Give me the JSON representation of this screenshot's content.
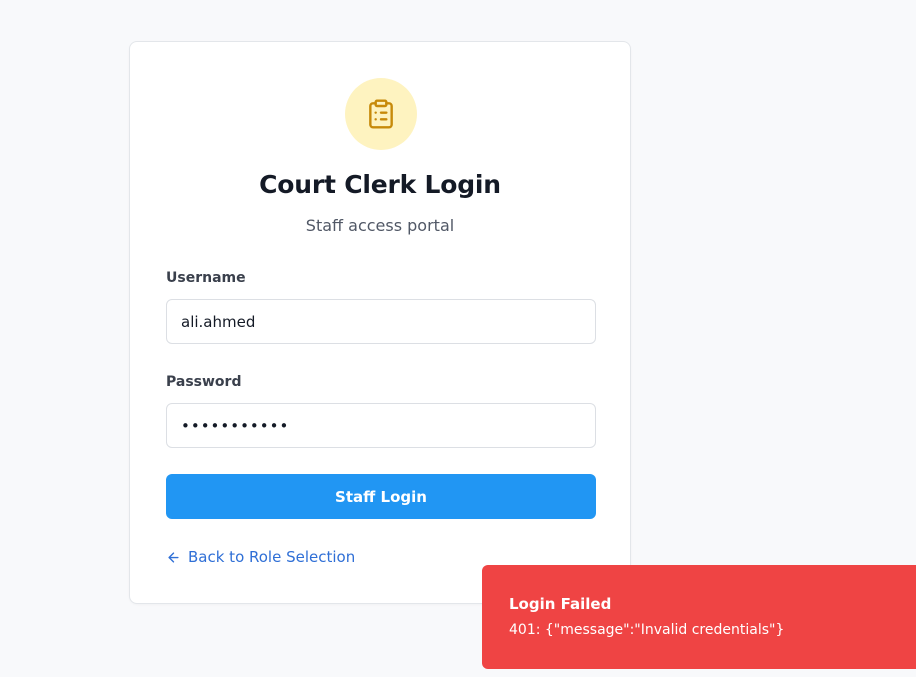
{
  "login": {
    "icon": "clipboard-list-icon",
    "title": "Court Clerk Login",
    "subtitle": "Staff access portal",
    "username_label": "Username",
    "username_value": "ali.ahmed",
    "password_label": "Password",
    "password_value": "•••••••••••",
    "submit_label": "Staff Login",
    "back_link_label": "Back to Role Selection",
    "back_icon": "arrow-left-icon"
  },
  "toast": {
    "title": "Login Failed",
    "message": "401: {\"message\":\"Invalid credentials\"}"
  },
  "colors": {
    "accent": "#2196f3",
    "icon_bg": "#fef3c0",
    "icon_fg": "#c78a0a",
    "error": "#ef4444",
    "link": "#2f6fd6"
  }
}
